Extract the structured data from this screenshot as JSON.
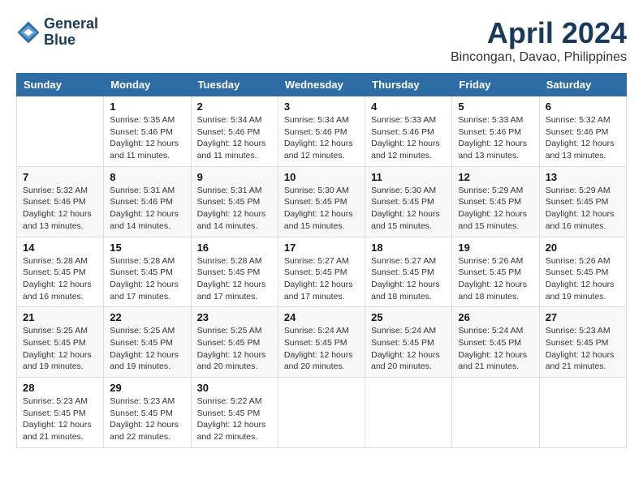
{
  "header": {
    "logo_line1": "General",
    "logo_line2": "Blue",
    "month_title": "April 2024",
    "location": "Bincongan, Davao, Philippines"
  },
  "days_of_week": [
    "Sunday",
    "Monday",
    "Tuesday",
    "Wednesday",
    "Thursday",
    "Friday",
    "Saturday"
  ],
  "weeks": [
    [
      {
        "num": "",
        "info": ""
      },
      {
        "num": "1",
        "info": "Sunrise: 5:35 AM\nSunset: 5:46 PM\nDaylight: 12 hours\nand 11 minutes."
      },
      {
        "num": "2",
        "info": "Sunrise: 5:34 AM\nSunset: 5:46 PM\nDaylight: 12 hours\nand 11 minutes."
      },
      {
        "num": "3",
        "info": "Sunrise: 5:34 AM\nSunset: 5:46 PM\nDaylight: 12 hours\nand 12 minutes."
      },
      {
        "num": "4",
        "info": "Sunrise: 5:33 AM\nSunset: 5:46 PM\nDaylight: 12 hours\nand 12 minutes."
      },
      {
        "num": "5",
        "info": "Sunrise: 5:33 AM\nSunset: 5:46 PM\nDaylight: 12 hours\nand 13 minutes."
      },
      {
        "num": "6",
        "info": "Sunrise: 5:32 AM\nSunset: 5:46 PM\nDaylight: 12 hours\nand 13 minutes."
      }
    ],
    [
      {
        "num": "7",
        "info": "Sunrise: 5:32 AM\nSunset: 5:46 PM\nDaylight: 12 hours\nand 13 minutes."
      },
      {
        "num": "8",
        "info": "Sunrise: 5:31 AM\nSunset: 5:46 PM\nDaylight: 12 hours\nand 14 minutes."
      },
      {
        "num": "9",
        "info": "Sunrise: 5:31 AM\nSunset: 5:45 PM\nDaylight: 12 hours\nand 14 minutes."
      },
      {
        "num": "10",
        "info": "Sunrise: 5:30 AM\nSunset: 5:45 PM\nDaylight: 12 hours\nand 15 minutes."
      },
      {
        "num": "11",
        "info": "Sunrise: 5:30 AM\nSunset: 5:45 PM\nDaylight: 12 hours\nand 15 minutes."
      },
      {
        "num": "12",
        "info": "Sunrise: 5:29 AM\nSunset: 5:45 PM\nDaylight: 12 hours\nand 15 minutes."
      },
      {
        "num": "13",
        "info": "Sunrise: 5:29 AM\nSunset: 5:45 PM\nDaylight: 12 hours\nand 16 minutes."
      }
    ],
    [
      {
        "num": "14",
        "info": "Sunrise: 5:28 AM\nSunset: 5:45 PM\nDaylight: 12 hours\nand 16 minutes."
      },
      {
        "num": "15",
        "info": "Sunrise: 5:28 AM\nSunset: 5:45 PM\nDaylight: 12 hours\nand 17 minutes."
      },
      {
        "num": "16",
        "info": "Sunrise: 5:28 AM\nSunset: 5:45 PM\nDaylight: 12 hours\nand 17 minutes."
      },
      {
        "num": "17",
        "info": "Sunrise: 5:27 AM\nSunset: 5:45 PM\nDaylight: 12 hours\nand 17 minutes."
      },
      {
        "num": "18",
        "info": "Sunrise: 5:27 AM\nSunset: 5:45 PM\nDaylight: 12 hours\nand 18 minutes."
      },
      {
        "num": "19",
        "info": "Sunrise: 5:26 AM\nSunset: 5:45 PM\nDaylight: 12 hours\nand 18 minutes."
      },
      {
        "num": "20",
        "info": "Sunrise: 5:26 AM\nSunset: 5:45 PM\nDaylight: 12 hours\nand 19 minutes."
      }
    ],
    [
      {
        "num": "21",
        "info": "Sunrise: 5:25 AM\nSunset: 5:45 PM\nDaylight: 12 hours\nand 19 minutes."
      },
      {
        "num": "22",
        "info": "Sunrise: 5:25 AM\nSunset: 5:45 PM\nDaylight: 12 hours\nand 19 minutes."
      },
      {
        "num": "23",
        "info": "Sunrise: 5:25 AM\nSunset: 5:45 PM\nDaylight: 12 hours\nand 20 minutes."
      },
      {
        "num": "24",
        "info": "Sunrise: 5:24 AM\nSunset: 5:45 PM\nDaylight: 12 hours\nand 20 minutes."
      },
      {
        "num": "25",
        "info": "Sunrise: 5:24 AM\nSunset: 5:45 PM\nDaylight: 12 hours\nand 20 minutes."
      },
      {
        "num": "26",
        "info": "Sunrise: 5:24 AM\nSunset: 5:45 PM\nDaylight: 12 hours\nand 21 minutes."
      },
      {
        "num": "27",
        "info": "Sunrise: 5:23 AM\nSunset: 5:45 PM\nDaylight: 12 hours\nand 21 minutes."
      }
    ],
    [
      {
        "num": "28",
        "info": "Sunrise: 5:23 AM\nSunset: 5:45 PM\nDaylight: 12 hours\nand 21 minutes."
      },
      {
        "num": "29",
        "info": "Sunrise: 5:23 AM\nSunset: 5:45 PM\nDaylight: 12 hours\nand 22 minutes."
      },
      {
        "num": "30",
        "info": "Sunrise: 5:22 AM\nSunset: 5:45 PM\nDaylight: 12 hours\nand 22 minutes."
      },
      {
        "num": "",
        "info": ""
      },
      {
        "num": "",
        "info": ""
      },
      {
        "num": "",
        "info": ""
      },
      {
        "num": "",
        "info": ""
      }
    ]
  ]
}
